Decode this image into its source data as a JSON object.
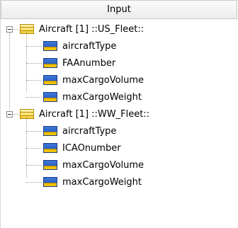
{
  "header": {
    "title": "Input"
  },
  "groups": [
    {
      "label": "Aircraft [1] ::US_Fleet::",
      "items": [
        "aircraftType",
        "FAAnumber",
        "maxCargoVolume",
        "maxCargoWeight"
      ]
    },
    {
      "label": "Aircraft [1] ::WW_Fleet::",
      "items": [
        "aircraftType",
        "ICAOnumber",
        "maxCargoVolume",
        "maxCargoWeight"
      ]
    }
  ],
  "icons": {
    "class": "class-icon",
    "attribute": "attribute-icon",
    "expander": "collapse-icon"
  }
}
